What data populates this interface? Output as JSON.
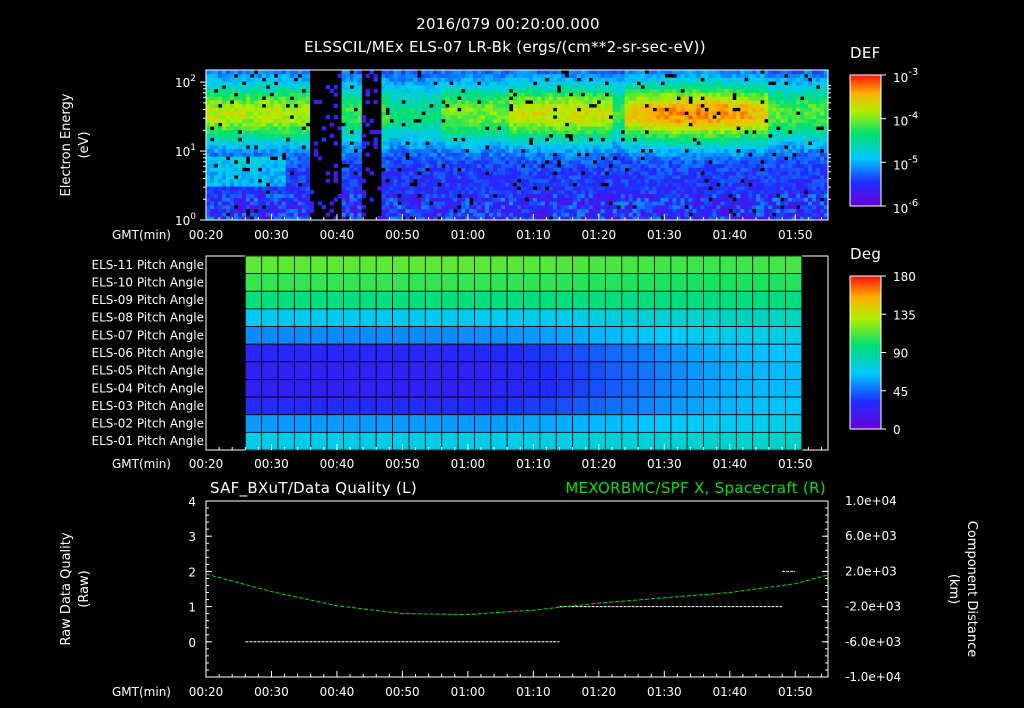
{
  "header": {
    "timestamp": "2016/079 00:20:00.000",
    "panel1_title": "ELSSCIL/MEx ELS-07 LR-Bk  (ergs/(cm**2-sr-sec-eV))"
  },
  "time_axis": {
    "prefix": "GMT(min)",
    "ticks": [
      "00:20",
      "00:30",
      "00:40",
      "00:50",
      "01:00",
      "01:10",
      "01:20",
      "01:30",
      "01:40",
      "01:50"
    ]
  },
  "panel1": {
    "ylabel_line1": "Electron Energy",
    "ylabel_line2": "(eV)",
    "y_ticks": [
      {
        "base": "10",
        "exp": "2"
      },
      {
        "base": "10",
        "exp": "1"
      },
      {
        "base": "10",
        "exp": "0"
      }
    ],
    "colorbar": {
      "label": "DEF",
      "ticks": [
        {
          "base": "10",
          "exp": "-3"
        },
        {
          "base": "10",
          "exp": "-4"
        },
        {
          "base": "10",
          "exp": "-5"
        },
        {
          "base": "10",
          "exp": "-6"
        }
      ]
    }
  },
  "panel2": {
    "row_labels": [
      "ELS-11 Pitch Angle",
      "ELS-10 Pitch Angle",
      "ELS-09 Pitch Angle",
      "ELS-08 Pitch Angle",
      "ELS-07 Pitch Angle",
      "ELS-06 Pitch Angle",
      "ELS-05 Pitch Angle",
      "ELS-04 Pitch Angle",
      "ELS-03 Pitch Angle",
      "ELS-02 Pitch Angle",
      "ELS-01 Pitch Angle"
    ],
    "colorbar": {
      "label": "Deg",
      "ticks": [
        "180",
        "135",
        "90",
        "45",
        "0"
      ]
    }
  },
  "panel3": {
    "left_title": "SAF_BXuT/Data Quality (L)",
    "right_title": "MEXORBMC/SPF X, Spacecraft (R)",
    "left_label_line1": "Raw Data Quality",
    "left_label_line2": "(Raw)",
    "right_label_line1": "Component Distance",
    "right_label_line2": "(km)",
    "left_ticks": [
      "4",
      "3",
      "2",
      "1",
      "0"
    ],
    "right_ticks": [
      "1.0e+04",
      "6.0e+03",
      "2.0e+03",
      "-2.0e+03",
      "-6.0e+03",
      "-1.0e+04"
    ]
  },
  "colors": {
    "background": "#000000",
    "axes": "#ffffff",
    "right_series": "#00e000"
  },
  "chart_data": [
    {
      "type": "heatmap",
      "title": "ELSSCIL/MEx ELS-07 LR-Bk  (ergs/(cm**2-sr-sec-eV))",
      "xlabel": "GMT(min)",
      "ylabel": "Electron Energy (eV)",
      "x_range_min": [
        20,
        115
      ],
      "y_scale": "log",
      "ylim": [
        1,
        150
      ],
      "colorbar_label": "DEF",
      "colorbar_scale": "log",
      "colorbar_range": [
        1e-06,
        0.001
      ],
      "description_features": {
        "quiet_gaps_min": [
          [
            36,
            41
          ],
          [
            44,
            47
          ]
        ],
        "peak_band_eV": [
          20,
          60
        ],
        "peak_interval_min": [
          85,
          104
        ]
      }
    },
    {
      "type": "heatmap",
      "title": "",
      "xlabel": "GMT(min)",
      "ylabel": "",
      "categories": [
        "ELS-11",
        "ELS-10",
        "ELS-09",
        "ELS-08",
        "ELS-07",
        "ELS-06",
        "ELS-05",
        "ELS-04",
        "ELS-03",
        "ELS-02",
        "ELS-01"
      ],
      "x_range_min": [
        26,
        111
      ],
      "colorbar_label": "Deg",
      "colorbar_range": [
        0,
        180
      ],
      "start_angles_deg": [
        115,
        108,
        96,
        68,
        52,
        28,
        24,
        24,
        30,
        55,
        70
      ],
      "end_angles_deg": [
        108,
        102,
        95,
        80,
        72,
        64,
        62,
        62,
        64,
        70,
        78
      ]
    },
    {
      "type": "line",
      "title": "SAF_BXuT/Data Quality (L)",
      "xlabel": "GMT(min)",
      "ylabel": "Raw Data Quality (Raw)",
      "ylim": [
        -1,
        4
      ],
      "series": [
        {
          "name": "SAF_BXuT/Data Quality",
          "segments": [
            {
              "x_min": [
                26,
                74
              ],
              "y": 0
            },
            {
              "x_min": [
                74,
                108
              ],
              "y": 1
            },
            {
              "x_min": [
                108,
                110
              ],
              "y": 2
            }
          ]
        }
      ]
    },
    {
      "type": "line",
      "title": "MEXORBMC/SPF X, Spacecraft (R)",
      "ylabel": "Component Distance (km)",
      "ylim": [
        -10000,
        10000
      ],
      "series": [
        {
          "name": "MEXORBMC/SPF X, Spacecraft",
          "x_min": [
            20,
            30,
            40,
            50,
            60,
            70,
            80,
            90,
            100,
            110,
            115
          ],
          "y_km": [
            1700,
            -300,
            -1900,
            -2800,
            -2900,
            -2400,
            -1600,
            -1000,
            -400,
            600,
            1600
          ]
        }
      ]
    }
  ]
}
